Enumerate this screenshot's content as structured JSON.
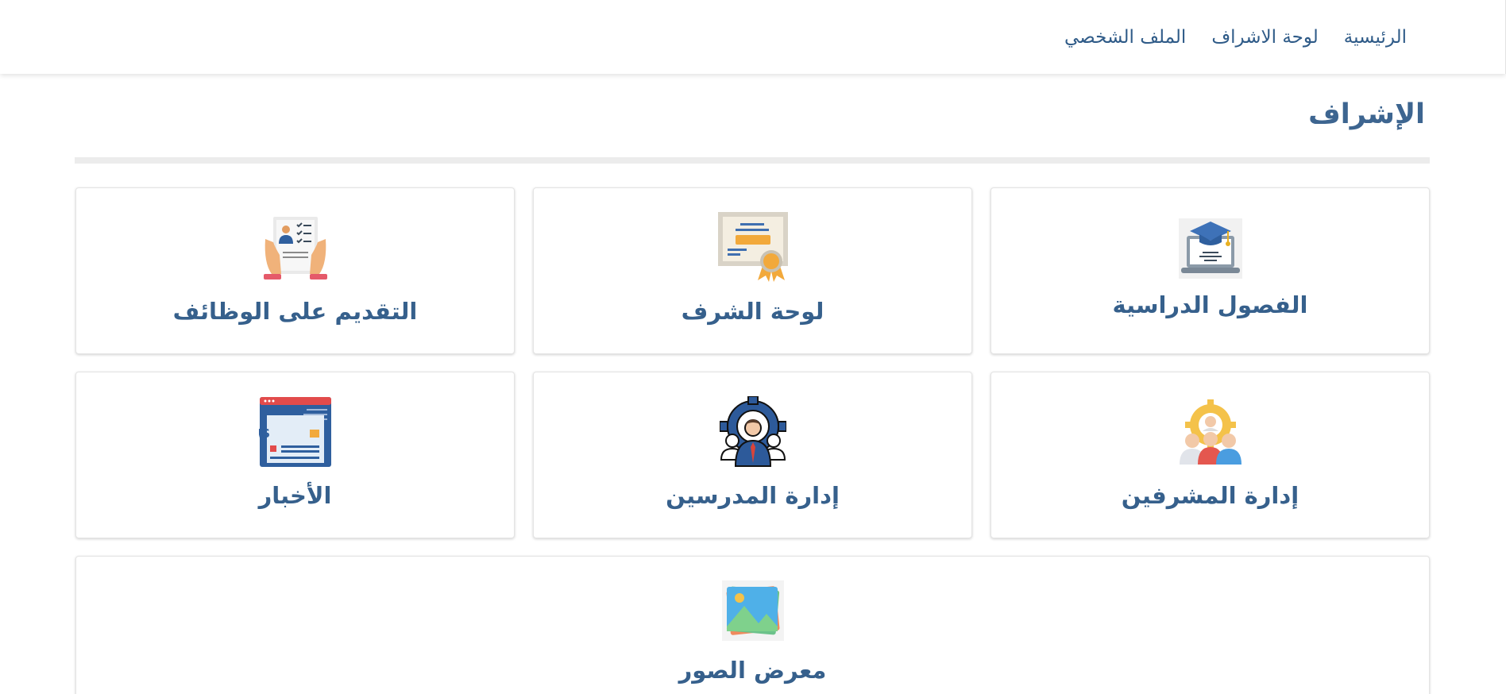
{
  "nav": {
    "links": [
      {
        "label": "الرئيسية"
      },
      {
        "label": "لوحة الاشراف"
      },
      {
        "label": "الملف الشخصي"
      }
    ]
  },
  "page": {
    "title": "الإشراف"
  },
  "cards": [
    {
      "label": "الفصول الدراسية",
      "icon": "graduation-laptop-icon"
    },
    {
      "label": "لوحة الشرف",
      "icon": "certificate-icon"
    },
    {
      "label": "التقديم على الوظائف",
      "icon": "job-application-icon"
    },
    {
      "label": "إدارة المشرفين",
      "icon": "supervisors-icon"
    },
    {
      "label": "إدارة المدرسين",
      "icon": "teachers-gear-icon"
    },
    {
      "label": "الأخبار",
      "icon": "news-icon"
    },
    {
      "label": "معرض الصور",
      "icon": "photo-gallery-icon"
    }
  ],
  "icon_texts": {
    "news": "NEWS"
  },
  "colors": {
    "primary_text": "#36608c",
    "nav_text": "#2f5b88",
    "divider": "#ececec"
  }
}
